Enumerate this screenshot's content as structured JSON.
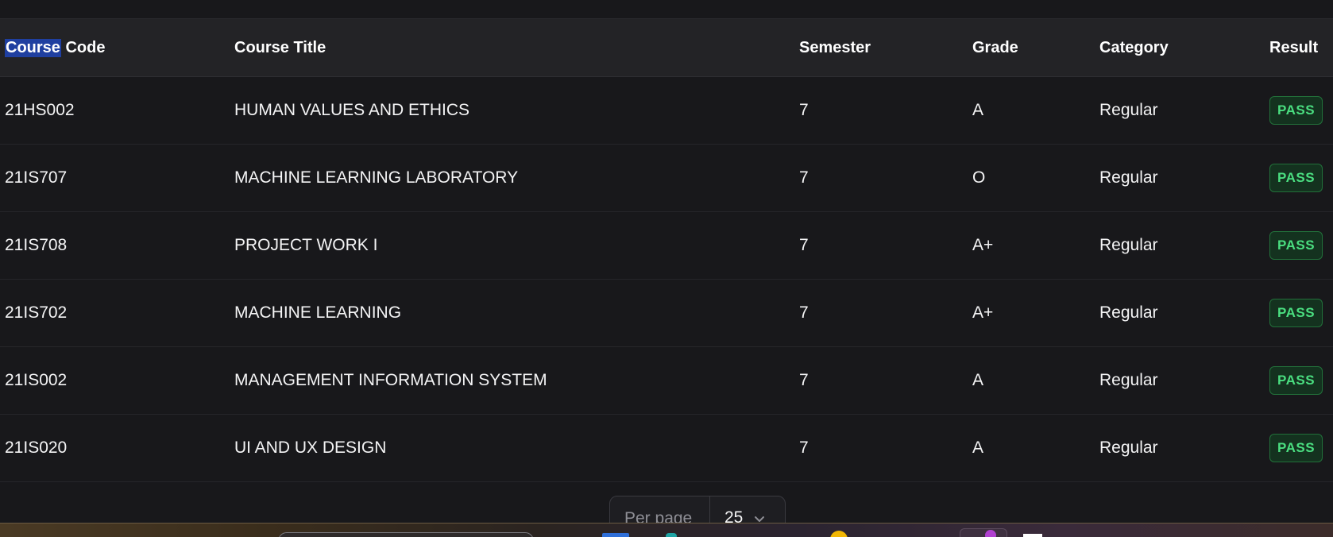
{
  "table": {
    "headers": {
      "course_code_selected": "Course",
      "course_code_rest": " Code",
      "course_title": "Course Title",
      "semester": "Semester",
      "grade": "Grade",
      "category": "Category",
      "result": "Result"
    },
    "rows": [
      {
        "code": "21HS002",
        "title": "HUMAN VALUES AND ETHICS",
        "semester": "7",
        "grade": "A",
        "category": "Regular",
        "result": "PASS"
      },
      {
        "code": "21IS707",
        "title": "MACHINE LEARNING LABORATORY",
        "semester": "7",
        "grade": "O",
        "category": "Regular",
        "result": "PASS"
      },
      {
        "code": "21IS708",
        "title": "PROJECT WORK I",
        "semester": "7",
        "grade": "A+",
        "category": "Regular",
        "result": "PASS"
      },
      {
        "code": "21IS702",
        "title": "MACHINE LEARNING",
        "semester": "7",
        "grade": "A+",
        "category": "Regular",
        "result": "PASS"
      },
      {
        "code": "21IS002",
        "title": "MANAGEMENT INFORMATION SYSTEM",
        "semester": "7",
        "grade": "A",
        "category": "Regular",
        "result": "PASS"
      },
      {
        "code": "21IS020",
        "title": "UI AND UX DESIGN",
        "semester": "7",
        "grade": "A",
        "category": "Regular",
        "result": "PASS"
      }
    ]
  },
  "pagination": {
    "per_page_label": "Per page",
    "per_page_value": "25",
    "dropdown_icon": "chevron-down-icon"
  },
  "colors": {
    "background": "#18181b",
    "header_background": "#232326",
    "pass_text": "#4ade80",
    "pass_background": "#14321f",
    "selection": "#1f3fa0"
  }
}
